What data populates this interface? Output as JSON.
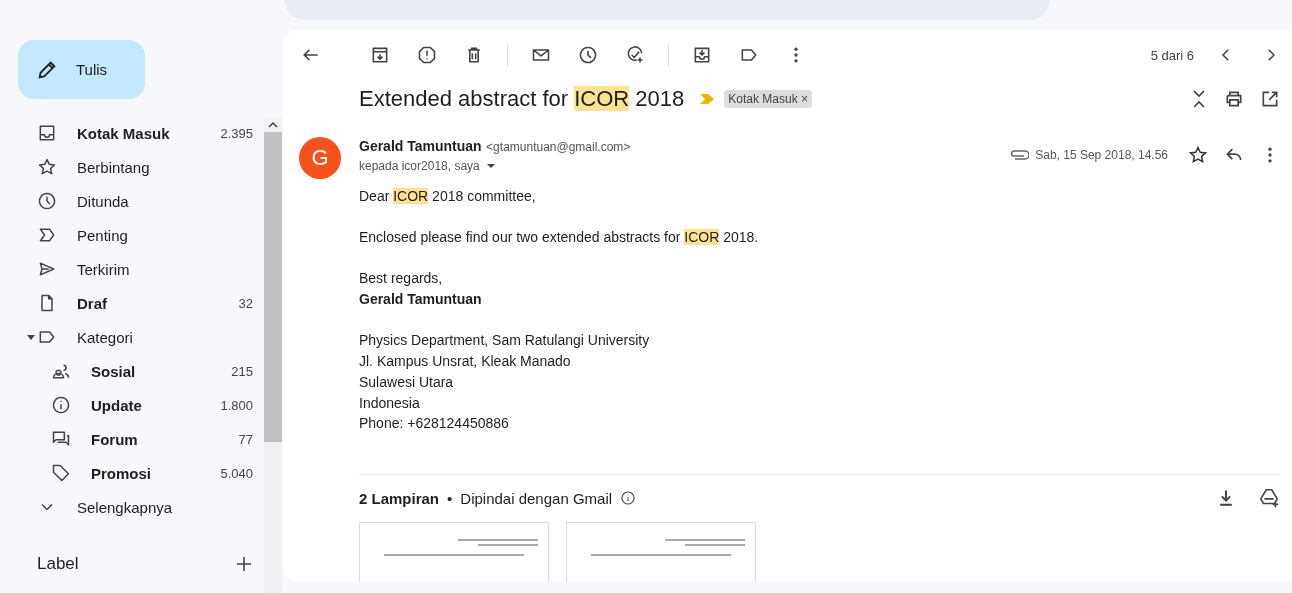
{
  "compose": {
    "label": "Tulis"
  },
  "sidebar": {
    "items": [
      {
        "kind": "inbox",
        "label": "Kotak Masuk",
        "count": "2.395",
        "unread": true
      },
      {
        "kind": "star",
        "label": "Berbintang",
        "unread": false
      },
      {
        "kind": "clock",
        "label": "Ditunda",
        "unread": false
      },
      {
        "kind": "important",
        "label": "Penting",
        "unread": false
      },
      {
        "kind": "send",
        "label": "Terkirim",
        "unread": false
      },
      {
        "kind": "document",
        "label": "Draf",
        "count": "32",
        "unread": true
      },
      {
        "kind": "label",
        "label": "Kategori",
        "unread": false,
        "expanded": true,
        "children": [
          {
            "kind": "people",
            "label": "Sosial",
            "count": "215",
            "unread": true
          },
          {
            "kind": "info",
            "label": "Update",
            "count": "1.800",
            "unread": true
          },
          {
            "kind": "chat",
            "label": "Forum",
            "count": "77",
            "unread": true
          },
          {
            "kind": "tag",
            "label": "Promosi",
            "count": "5.040",
            "unread": true
          }
        ]
      },
      {
        "kind": "chevron",
        "label": "Selengkapnya",
        "unread": false
      }
    ],
    "labels_heading": "Label"
  },
  "toolbar": {
    "pager": "5 dari 6"
  },
  "message": {
    "subject": [
      {
        "text": "Extended abstract for ",
        "highlight": false
      },
      {
        "text": "ICOR",
        "highlight": true
      },
      {
        "text": " 2018",
        "highlight": false
      }
    ],
    "important": true,
    "folder_chip": "Kotak Masuk",
    "chip_remove": "×",
    "avatar_letter": "G",
    "sender_name": "Gerald Tamuntuan",
    "sender_email": "<gtamuntuan@gmail.com>",
    "recipients": "kepada icor2018, saya",
    "date": "Sab, 15 Sep 2018, 14.56",
    "has_attachment": true,
    "body": [
      [
        {
          "bold": false,
          "segments": [
            {
              "text": "Dear ",
              "highlight": false
            },
            {
              "text": "ICOR",
              "highlight": true
            },
            {
              "text": " 2018 committee,",
              "highlight": false
            }
          ]
        }
      ],
      [
        {
          "bold": false,
          "segments": [
            {
              "text": "Enclosed please find our two extended abstracts for ",
              "highlight": false
            },
            {
              "text": "ICOR",
              "highlight": true
            },
            {
              "text": " 2018.",
              "highlight": false
            }
          ]
        }
      ],
      [
        {
          "bold": false,
          "segments": [
            {
              "text": "Best regards,",
              "highlight": false
            }
          ]
        },
        {
          "bold": true,
          "segments": [
            {
              "text": "Gerald Tamuntuan",
              "highlight": false
            }
          ]
        }
      ],
      [
        {
          "bold": false,
          "segments": [
            {
              "text": "Physics Department, Sam Ratulangi University",
              "highlight": false
            }
          ]
        },
        {
          "bold": false,
          "segments": [
            {
              "text": "Jl. Kampus Unsrat, Kleak Manado",
              "highlight": false
            }
          ]
        },
        {
          "bold": false,
          "segments": [
            {
              "text": "Sulawesi Utara",
              "highlight": false
            }
          ]
        },
        {
          "bold": false,
          "segments": [
            {
              "text": "Indonesia",
              "highlight": false
            }
          ]
        },
        {
          "bold": false,
          "segments": [
            {
              "text": "Phone: +628124450886",
              "highlight": false
            }
          ]
        }
      ]
    ],
    "attachments": {
      "count_label": "2 Lampiran",
      "separator": "•",
      "scan_note": "Dipindai dengan Gmail",
      "items": [
        {
          "kind": "document"
        },
        {
          "kind": "document"
        }
      ]
    }
  }
}
